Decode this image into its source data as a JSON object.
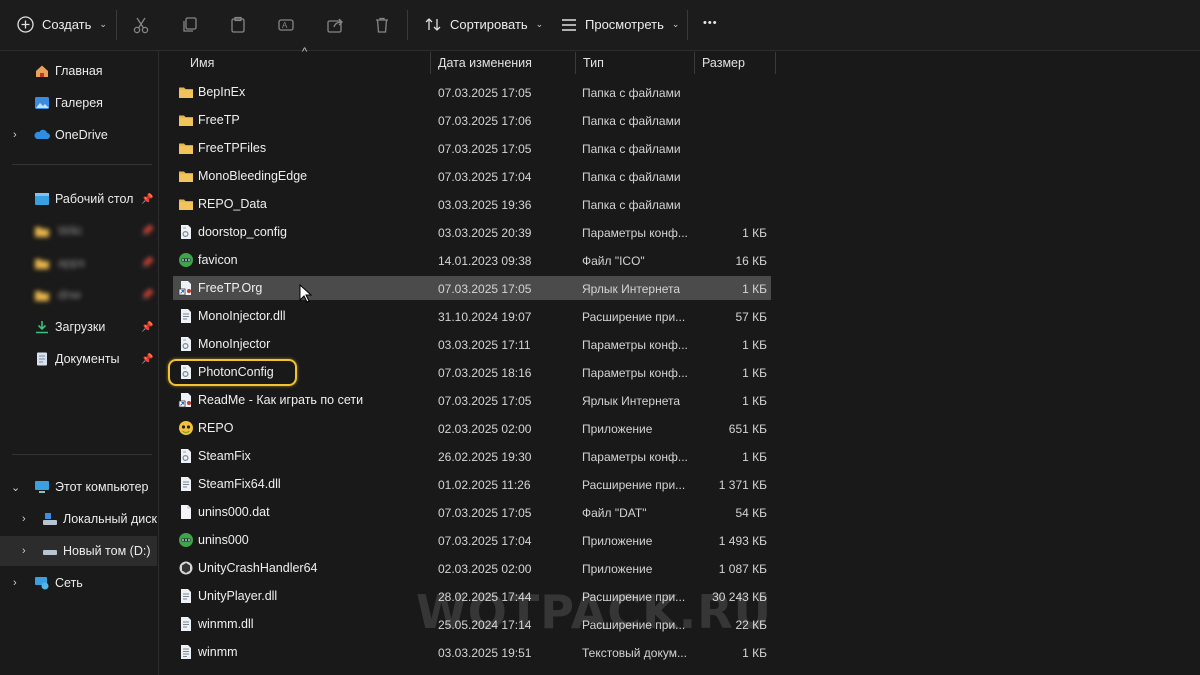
{
  "toolbar": {
    "new_label": "Создать",
    "sort_label": "Сортировать",
    "view_label": "Просмотреть",
    "more_label": "•••",
    "icons": [
      "cut-icon",
      "copy-icon",
      "paste-icon",
      "rename-icon",
      "share-icon",
      "delete-icon"
    ]
  },
  "sidebar": {
    "home": "Главная",
    "gallery": "Галерея",
    "onedrive": "OneDrive",
    "desktop": "Рабочий стол",
    "blurred1": "Wiki",
    "blurred2": "apps",
    "blurred3": "dnw",
    "downloads": "Загрузки",
    "documents": "Документы",
    "this_pc": "Этот компьютер",
    "local_disk": "Локальный диск",
    "new_volume": "Новый том (D:)",
    "network": "Сеть"
  },
  "columns": {
    "name": "Имя",
    "date": "Дата изменения",
    "type": "Тип",
    "size": "Размер"
  },
  "files": [
    {
      "name": "BepInEx",
      "date": "07.03.2025 17:05",
      "type": "Папка с файлами",
      "size": "",
      "icon": "folder-icon"
    },
    {
      "name": "FreeTP",
      "date": "07.03.2025 17:06",
      "type": "Папка с файлами",
      "size": "",
      "icon": "folder-icon"
    },
    {
      "name": "FreeTPFiles",
      "date": "07.03.2025 17:05",
      "type": "Папка с файлами",
      "size": "",
      "icon": "folder-icon"
    },
    {
      "name": "MonoBleedingEdge",
      "date": "07.03.2025 17:04",
      "type": "Папка с файлами",
      "size": "",
      "icon": "folder-icon"
    },
    {
      "name": "REPO_Data",
      "date": "03.03.2025 19:36",
      "type": "Папка с файлами",
      "size": "",
      "icon": "folder-icon"
    },
    {
      "name": "doorstop_config",
      "date": "03.03.2025 20:39",
      "type": "Параметры конф...",
      "size": "1 КБ",
      "icon": "config-file-icon"
    },
    {
      "name": "favicon",
      "date": "14.01.2023 09:38",
      "type": "Файл \"ICO\"",
      "size": "16 КБ",
      "icon": "ico-file-icon"
    },
    {
      "name": "FreeTP.Org",
      "date": "07.03.2025 17:05",
      "type": "Ярлык Интернета",
      "size": "1 КБ",
      "icon": "internet-shortcut-icon"
    },
    {
      "name": "MonoInjector.dll",
      "date": "31.10.2024 19:07",
      "type": "Расширение при...",
      "size": "57 КБ",
      "icon": "dll-file-icon"
    },
    {
      "name": "MonoInjector",
      "date": "03.03.2025 17:11",
      "type": "Параметры конф...",
      "size": "1 КБ",
      "icon": "config-file-icon"
    },
    {
      "name": "PhotonConfig",
      "date": "07.03.2025 18:16",
      "type": "Параметры конф...",
      "size": "1 КБ",
      "icon": "config-file-icon"
    },
    {
      "name": "ReadMe - Как играть по сети",
      "date": "07.03.2025 17:05",
      "type": "Ярлык Интернета",
      "size": "1 КБ",
      "icon": "internet-shortcut-icon"
    },
    {
      "name": "REPO",
      "date": "02.03.2025 02:00",
      "type": "Приложение",
      "size": "651 КБ",
      "icon": "app-icon"
    },
    {
      "name": "SteamFix",
      "date": "26.02.2025 19:30",
      "type": "Параметры конф...",
      "size": "1 КБ",
      "icon": "config-file-icon"
    },
    {
      "name": "SteamFix64.dll",
      "date": "01.02.2025 11:26",
      "type": "Расширение при...",
      "size": "1 371 КБ",
      "icon": "dll-file-icon"
    },
    {
      "name": "unins000.dat",
      "date": "07.03.2025 17:05",
      "type": "Файл \"DAT\"",
      "size": "54 КБ",
      "icon": "dat-file-icon"
    },
    {
      "name": "unins000",
      "date": "07.03.2025 17:04",
      "type": "Приложение",
      "size": "1 493 КБ",
      "icon": "ico-file-icon"
    },
    {
      "name": "UnityCrashHandler64",
      "date": "02.03.2025 02:00",
      "type": "Приложение",
      "size": "1 087 КБ",
      "icon": "unity-app-icon"
    },
    {
      "name": "UnityPlayer.dll",
      "date": "28.02.2025 17:44",
      "type": "Расширение при...",
      "size": "30 243 КБ",
      "icon": "dll-file-icon"
    },
    {
      "name": "winmm.dll",
      "date": "25.05.2024 17:14",
      "type": "Расширение при...",
      "size": "22 КБ",
      "icon": "dll-file-icon"
    },
    {
      "name": "winmm",
      "date": "03.03.2025 19:51",
      "type": "Текстовый докум...",
      "size": "1 КБ",
      "icon": "text-file-icon"
    }
  ],
  "selected_row": "FreeTP.Org",
  "highlighted_row": "PhotonConfig",
  "watermark": "WOTPACK.RU",
  "colors": {
    "highlight": "#f2c230",
    "folder": "#e8b64a",
    "selection": "#4b4b4b"
  }
}
